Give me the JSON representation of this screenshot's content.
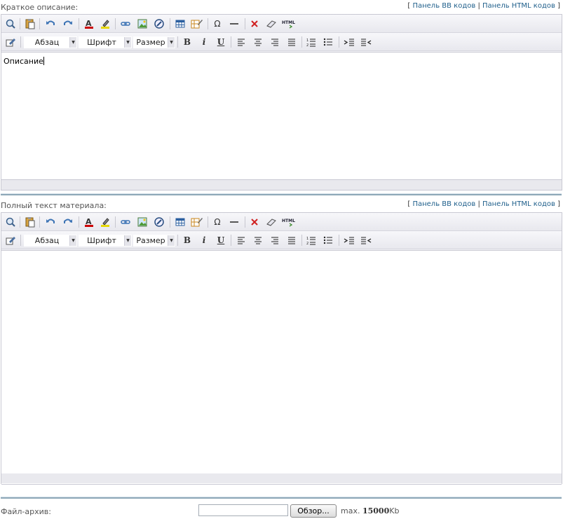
{
  "editors": [
    {
      "label": "Краткое описание:",
      "link_bb": "Панель BB кодов",
      "link_html": "Панель HTML кодов",
      "format_select": "Абзац",
      "font_select": "Шрифт",
      "size_select": "Размер",
      "content": "Описание"
    },
    {
      "label": "Полный текст материала:",
      "link_bb": "Панель BB кодов",
      "link_html": "Панель HTML кодов",
      "format_select": "Абзац",
      "font_select": "Шрифт",
      "size_select": "Размер",
      "content": ""
    }
  ],
  "toolbar_icons": {
    "preview": "search-icon",
    "paste": "paste-icon",
    "undo": "undo-icon",
    "redo": "redo-icon",
    "text_color": "text-color-icon",
    "highlight": "highlight-icon",
    "link": "link-icon",
    "image": "image-icon",
    "anchor": "anchor-icon",
    "table": "table-icon",
    "table_edit": "table-edit-icon",
    "omega": "omega-icon",
    "hr": "hr-icon",
    "remove": "remove-icon",
    "eraser": "eraser-icon",
    "html": "HTML",
    "edit": "edit-icon"
  },
  "file": {
    "label": "Файл-архив:",
    "browse_label": "Обзор...",
    "max_prefix": "max.",
    "max_value": "15000",
    "max_unit": "Kb"
  },
  "colors": {
    "link": "#1f5f8b",
    "toolbar_bg": "#ececf1",
    "divider": "#8ea8b8",
    "text_color_red": "#cc0000"
  }
}
